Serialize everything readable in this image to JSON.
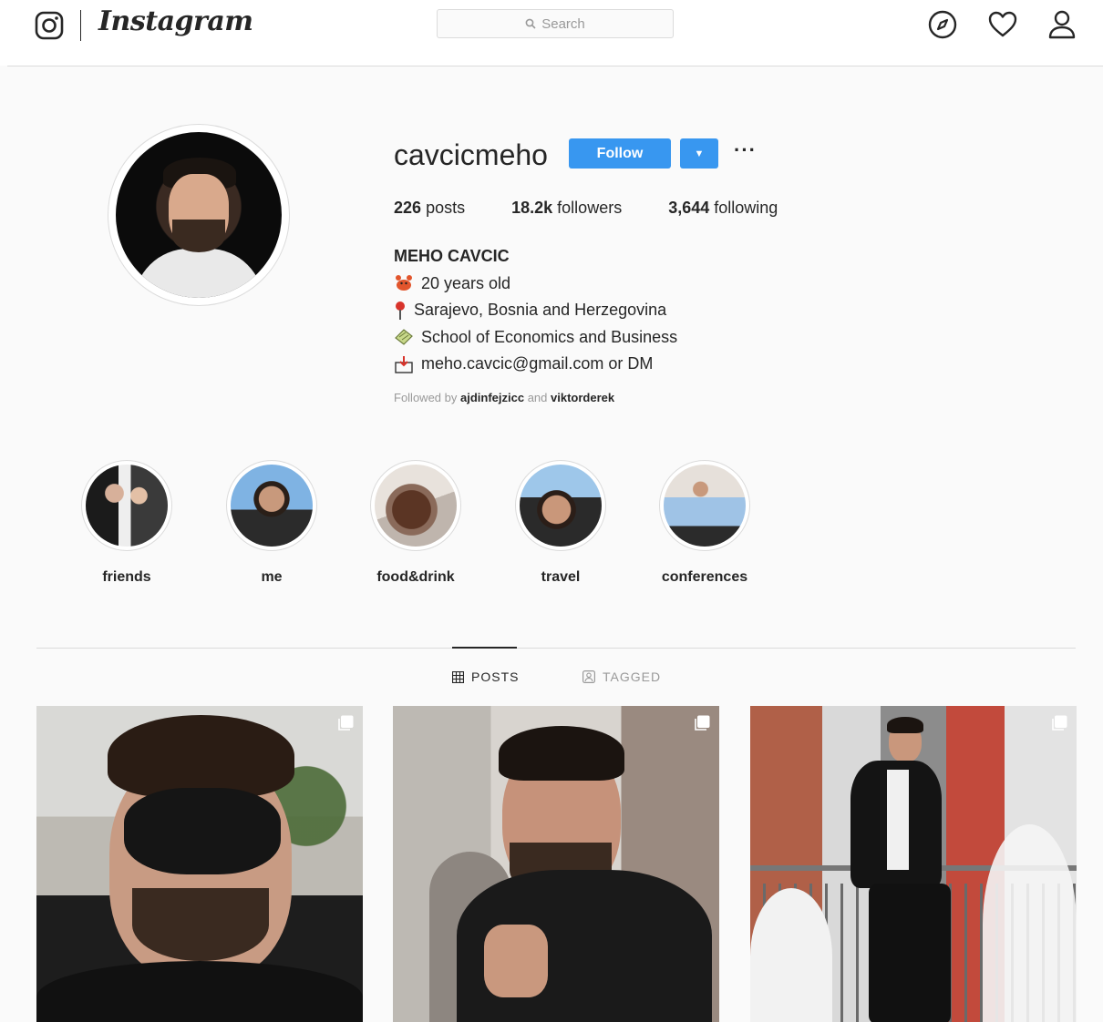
{
  "nav": {
    "wordmark": "Instagram",
    "search_placeholder": "Search",
    "icons": [
      "instagram-glyph-icon",
      "compass-icon",
      "heart-icon",
      "person-icon"
    ]
  },
  "profile": {
    "username": "cavcicmeho",
    "follow_label": "Follow",
    "more_label": "···",
    "stats": {
      "posts_count": "226",
      "posts_label": "posts",
      "followers_count": "18.2k",
      "followers_label": "followers",
      "following_count": "3,644",
      "following_label": "following"
    },
    "full_name": "MEHO CAVCIC",
    "bio_lines": [
      {
        "icon": "crab-emoji-icon",
        "text": "20 years old"
      },
      {
        "icon": "pin-emoji-icon",
        "text": "Sarajevo, Bosnia and Herzegovina"
      },
      {
        "icon": "book-emoji-icon",
        "text": "School of Economics and Business"
      },
      {
        "icon": "inbox-emoji-icon",
        "text": "meho.cavcic@gmail.com or DM"
      }
    ],
    "followed_by": {
      "prefix": "Followed by",
      "user1": "ajdinfejzicc",
      "joiner": "and",
      "user2": "viktorderek"
    }
  },
  "highlights": [
    {
      "label": "friends"
    },
    {
      "label": "me"
    },
    {
      "label": "food&drink"
    },
    {
      "label": "travel"
    },
    {
      "label": "conferences"
    }
  ],
  "tabs": {
    "posts_label": "POSTS",
    "tagged_label": "TAGGED",
    "active": "posts"
  },
  "colors": {
    "accent": "#3897f0",
    "text": "#262626",
    "muted": "#999999",
    "border": "#dbdbdb",
    "background": "#fafafa"
  }
}
